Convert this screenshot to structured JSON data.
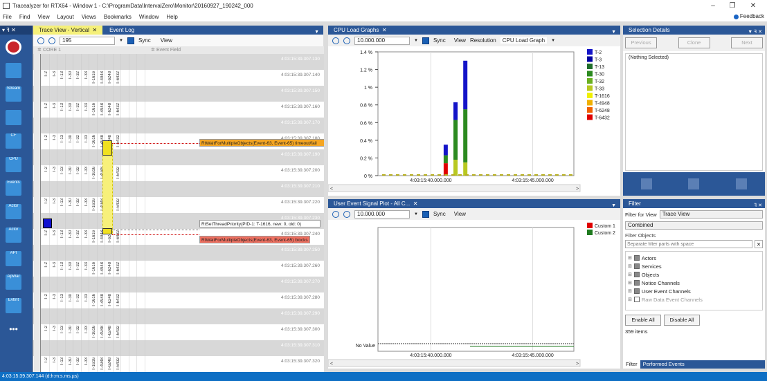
{
  "window": {
    "title": "Tracealyzer for RTX64 - Window 1 - C:\\ProgramData\\IntervalZero\\Monitor\\20160927_190242_000",
    "minimize": "–",
    "restore": "❐",
    "close": "✕"
  },
  "menu": [
    "File",
    "Find",
    "View",
    "Layout",
    "Views",
    "Bookmarks",
    "Window",
    "Help"
  ],
  "feedback": "Feedback",
  "leftbar": {
    "header": "▾ ꟻ ✕",
    "tools": [
      {
        "name": "record-icon",
        "label": ""
      },
      {
        "name": "trace-view-icon",
        "label": ""
      },
      {
        "name": "stream-icon",
        "label": "Stream"
      },
      {
        "name": "object-icon",
        "label": ""
      },
      {
        "name": "cf-icon",
        "label": "CF"
      },
      {
        "name": "cpu-icon",
        "label": "CPU"
      },
      {
        "name": "events-icon",
        "label": "Events"
      },
      {
        "name": "actor-icon",
        "label": "Actor"
      },
      {
        "name": "actor2-icon",
        "label": "Actor"
      },
      {
        "name": "api-icon",
        "label": "API"
      },
      {
        "name": "apwar-icon",
        "label": "ApWar"
      },
      {
        "name": "evtint-icon",
        "label": "EvtInt"
      },
      {
        "name": "more-icon",
        "label": "•••"
      }
    ]
  },
  "trace": {
    "tabs": [
      "Trace View - Vertical",
      "Event Log"
    ],
    "close": "✕",
    "zoom_value": "195",
    "sync": "Sync",
    "view": "View",
    "core": "CORE 1",
    "event_field": "Event Field",
    "columns": [
      "T-2",
      "T-3",
      "T-13",
      "T-30",
      "T-32",
      "T-33",
      "T-1616",
      "T-4948",
      "T-6248",
      "T-6432"
    ],
    "timestamps": [
      "4:03:15:39.307.130",
      "4:03:15:39.307.140",
      "4:03:15:39.307.150",
      "4:03:15:39.307.160",
      "4:03:15:39.307.170",
      "4:03:15:39.307.180",
      "4:03:15:39.307.190",
      "4:03:15:39.307.200",
      "4:03:15:39.307.210",
      "4:03:15:39.307.220",
      "4:03:15:39.307.230",
      "4:03:15:39.307.240",
      "4:03:15:39.307.250",
      "4:03:15:39.307.260",
      "4:03:15:39.307.270",
      "4:03:15:39.307.280",
      "4:03:15:39.307.290",
      "4:03:15:39.307.300",
      "4:03:15:39.307.310",
      "4:03:15:39.307.320"
    ],
    "events": [
      {
        "text": "RtWaitForMultipleObjects(Event-63, Event-65) timeout/fail",
        "color": "#f5a623"
      },
      {
        "text": "RtSetThreadPriority(PID-1: T-1616, new: 0, old: 0)",
        "color": "#ffffff"
      },
      {
        "text": "RtWaitForMultipleObjects(Event-63, Event-65) blocks",
        "color": "#f07060"
      }
    ]
  },
  "cpu": {
    "tab": "CPU Load Graphs",
    "zoom_value": "10.000.000",
    "sync": "Sync",
    "view": "View",
    "resolution": "Resolution",
    "graph": "CPU Load Graph",
    "xticks": [
      "4:03:15:40.000.000",
      "4:03:15:45.000.000"
    ]
  },
  "chart_data": [
    {
      "type": "bar",
      "title": "",
      "ylabel": "",
      "yticks": [
        "1.4 %",
        "1.2 %",
        "1 %",
        "0.8 %",
        "0.6 %",
        "0.4 %",
        "0.2 %",
        "0 %"
      ],
      "ylim": [
        0,
        1.4
      ],
      "legend": "right",
      "series": [
        {
          "name": "T-2",
          "color": "#1414c8"
        },
        {
          "name": "T-3",
          "color": "#0000a0"
        },
        {
          "name": "T-13",
          "color": "#1f6e2a"
        },
        {
          "name": "T-30",
          "color": "#2c8a20"
        },
        {
          "name": "T-32",
          "color": "#6ab020"
        },
        {
          "name": "T-33",
          "color": "#b8c820"
        },
        {
          "name": "T-1616",
          "color": "#f0f000"
        },
        {
          "name": "T-4948",
          "color": "#f0b000"
        },
        {
          "name": "T-6248",
          "color": "#f06000"
        },
        {
          "name": "T-6432",
          "color": "#e00000"
        }
      ],
      "stacks": [
        {
          "x": 0.36,
          "segments": [
            {
              "series": "T-6432",
              "value": 0.14
            },
            {
              "series": "T-30",
              "value": 0.09
            },
            {
              "series": "T-2",
              "value": 0.12
            }
          ]
        },
        {
          "x": 0.38,
          "segments": [
            {
              "series": "T-33",
              "value": 0.18
            },
            {
              "series": "T-30",
              "value": 0.45
            },
            {
              "series": "T-2",
              "value": 0.2
            }
          ]
        },
        {
          "x": 0.4,
          "segments": [
            {
              "series": "T-33",
              "value": 0.15
            },
            {
              "series": "T-30",
              "value": 0.6
            },
            {
              "series": "T-2",
              "value": 0.55
            }
          ]
        }
      ]
    },
    {
      "type": "line",
      "title": "",
      "series": [
        {
          "name": "Custom 1",
          "color": "#e00000"
        },
        {
          "name": "Custom 2",
          "color": "#1f7a1f"
        }
      ],
      "yticks": [
        "No Value"
      ],
      "xticks": [
        "4:03:15:40.000.000",
        "4:03:15:45.000.000"
      ]
    }
  ],
  "usp": {
    "tab": "User Event Signal Plot - All C...",
    "zoom_value": "10.000.000",
    "sync": "Sync",
    "view": "View"
  },
  "selection": {
    "title": "Selection Details",
    "prev": "Previous",
    "clone": "Clone",
    "next": "Next",
    "nothing": "(Nothing Selected)"
  },
  "filter": {
    "title": "Filter",
    "filter_for_view_label": "Filter for View",
    "filter_for_view_value": "Trace View",
    "combined": "Combined",
    "filter_objects": "Filter Objects",
    "placeholder": "Separate filter parts with space",
    "tree": [
      "Actors",
      "Services",
      "Objects",
      "Notice Channels",
      "User Event Channels",
      "Raw Data Event Channels"
    ],
    "enable_all": "Enable All",
    "disable_all": "Disable All",
    "items": "359 items",
    "tab_filter": "Filter",
    "tab_performed": "Performed Events"
  },
  "status": "4:03:15:39.307.144 (d:h:m:s.ms.µs)"
}
